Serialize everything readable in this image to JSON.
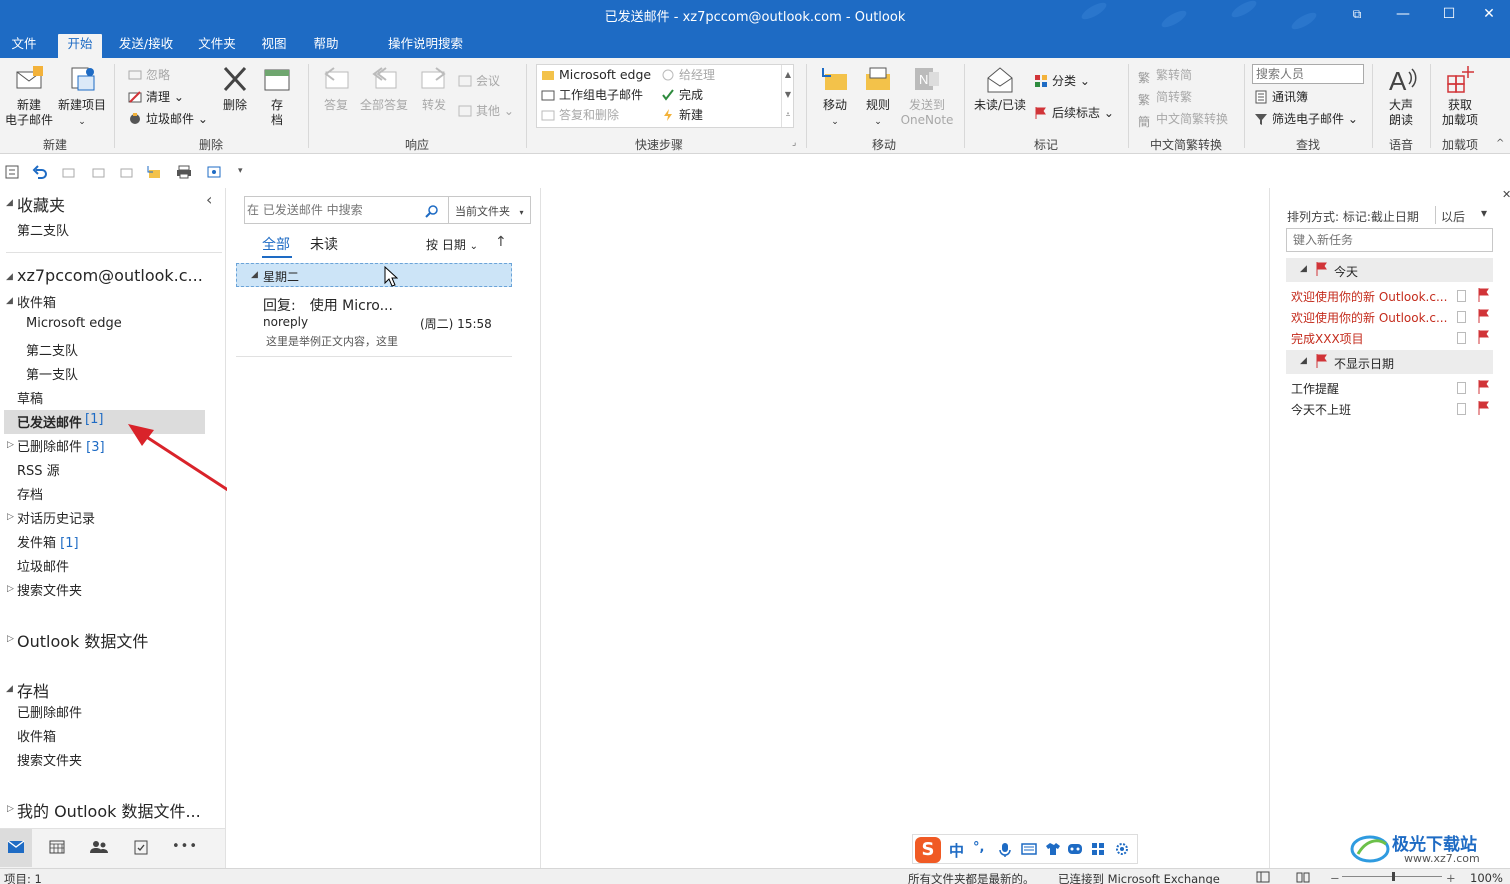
{
  "window": {
    "title": "已发送邮件 - xz7pccom@outlook.com  -  Outlook",
    "restore_glyph": "⧉",
    "minimize_glyph": "—",
    "maximize_glyph": "☐",
    "close_glyph": "✕"
  },
  "tabs": [
    {
      "label": "文件"
    },
    {
      "label": "开始"
    },
    {
      "label": "发送/接收"
    },
    {
      "label": "文件夹"
    },
    {
      "label": "视图"
    },
    {
      "label": "帮助"
    },
    {
      "label": "操作说明搜索"
    }
  ],
  "ribbon": {
    "new": {
      "new_mail_1": "新建",
      "new_mail_2": "电子邮件",
      "new_item": "新建项目",
      "group": "新建"
    },
    "delete": {
      "ignore": "忽略",
      "clean": "清理",
      "junk": "垃圾邮件",
      "delete": "删除",
      "archive_1": "存",
      "archive_2": "档",
      "group": "删除"
    },
    "respond": {
      "reply": "答复",
      "reply_all": "全部答复",
      "forward": "转发",
      "meeting": "会议",
      "more": "其他",
      "group": "响应"
    },
    "quicksteps": {
      "items": [
        "Microsoft edge",
        "工作组电子邮件",
        "答复和删除",
        "给经理",
        "完成",
        "新建"
      ],
      "group": "快速步骤"
    },
    "move": {
      "move": "移动",
      "rules": "规则",
      "onenote_1": "发送到",
      "onenote_2": "OneNote",
      "group": "移动"
    },
    "tags": {
      "unread": "未读/已读",
      "categorize": "分类",
      "followup": "后续标志",
      "group": "标记"
    },
    "chinese": {
      "to_simp": "繁转简",
      "to_trad": "简转繁",
      "convert": "中文简繁转换",
      "group": "中文简繁转换"
    },
    "find": {
      "search_people_placeholder": "搜索人员",
      "address_book": "通讯簿",
      "filter": "筛选电子邮件",
      "group": "查找"
    },
    "speech": {
      "read_1": "大声",
      "read_2": "朗读",
      "group": "语音"
    },
    "addins": {
      "get_1": "获取",
      "get_2": "加载项",
      "group": "加载项"
    }
  },
  "nav": {
    "favorites": "收藏夹",
    "fav_item": "第二支队",
    "account": "xz7pccom@outlook.c...",
    "inbox": "收件箱",
    "inbox_sub": [
      "Microsoft edge",
      "第二支队",
      "第一支队"
    ],
    "drafts": "草稿",
    "sent": "已发送邮件",
    "sent_count": "[1]",
    "deleted": "已删除邮件",
    "deleted_count": "[3]",
    "rss": "RSS 源",
    "archive": "存档",
    "conv_history": "对话历史记录",
    "outbox": "发件箱",
    "outbox_count": "[1]",
    "junk": "垃圾邮件",
    "search_folders": "搜索文件夹",
    "data_file": "Outlook 数据文件",
    "archive_root": "存档",
    "archive_items": [
      "已删除邮件",
      "收件箱",
      "搜索文件夹"
    ],
    "my_data_file": "我的 Outlook 数据文件...",
    "collapse_glyph": "‹",
    "more_glyph": "•••"
  },
  "list": {
    "search_placeholder": "在 已发送邮件 中搜索",
    "scope": "当前文件夹",
    "filter_all": "全部",
    "filter_unread": "未读",
    "sort": "按 日期",
    "group_header": "星期二",
    "messages": [
      {
        "subject": "回复:　使用 Micro...",
        "from": "noreply",
        "time": "(周二) 15:58",
        "preview": "这里是举例正文内容，这里"
      }
    ]
  },
  "todo": {
    "arrange": "排列方式: 标记:截止日期",
    "order": "以后",
    "new_task_placeholder": "键入新任务",
    "today": "今天",
    "today_tasks": [
      "欢迎使用你的新 Outlook.c...",
      "欢迎使用你的新 Outlook.c...",
      "完成XXX项目"
    ],
    "no_date": "不显示日期",
    "no_date_tasks": [
      "工作提醒",
      "今天不上班"
    ],
    "close_glyph": "✕"
  },
  "ime": {
    "lang": "中",
    "punct": "°,",
    "logo": "S"
  },
  "status": {
    "items": "项目: 1",
    "sync": "所有文件夹都是最新的。",
    "connected": "已连接到 Microsoft Exchange",
    "zoom": "100%"
  },
  "watermark": {
    "name": "极光下载站",
    "url": "www.xz7.com"
  },
  "colors": {
    "accent": "#1e6bc4",
    "task_red": "#c42b1c",
    "flag_red": "#d13438",
    "selected": "#cce4f7"
  }
}
